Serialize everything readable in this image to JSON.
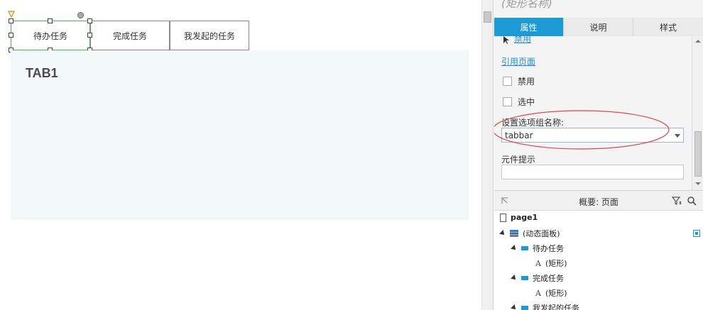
{
  "canvas": {
    "tabs": [
      {
        "label": "待办任务"
      },
      {
        "label": "完成任务"
      },
      {
        "label": "我发起的任务"
      }
    ],
    "panel_title": "TAB1"
  },
  "inspector": {
    "widget_name": "(矩形名称)",
    "tabs": [
      {
        "label": "属性",
        "active": true
      },
      {
        "label": "说明",
        "active": false
      },
      {
        "label": "样式",
        "active": false
      }
    ],
    "top_link": "禁用",
    "ref_page_link": "引用页面",
    "disabled_label": "禁用",
    "selected_label": "选中",
    "group_name_label": "设置选项组名称:",
    "group_name_value": "tabbar",
    "tooltip_label": "元件提示",
    "tooltip_value": "",
    "annotation_color": "#d9474f",
    "accent_color": "#1b9ad6"
  },
  "outline": {
    "title": "概要: 页面",
    "items": [
      {
        "label": "page1",
        "type": "page"
      },
      {
        "label": "(动态面板)",
        "type": "dynamic-panel"
      },
      {
        "label": "待办任务",
        "type": "state"
      },
      {
        "label": "(矩形)",
        "type": "rectangle"
      },
      {
        "label": "完成任务",
        "type": "state"
      },
      {
        "label": "(矩形)",
        "type": "rectangle"
      },
      {
        "label": "我发起的任务",
        "type": "state"
      }
    ]
  }
}
